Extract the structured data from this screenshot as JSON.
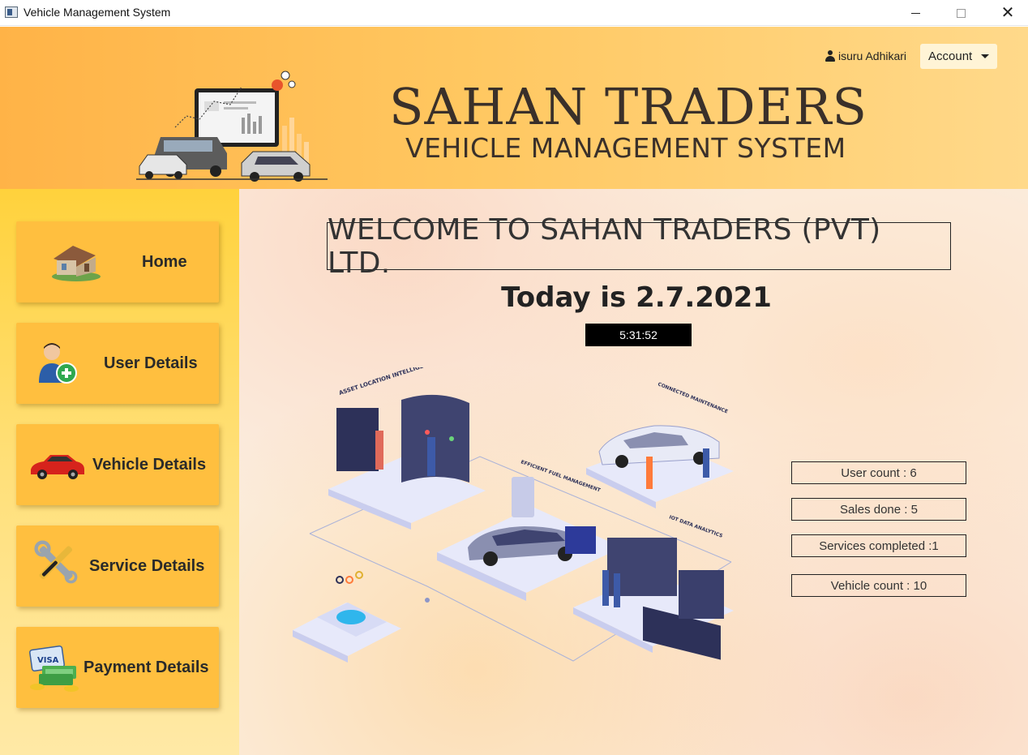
{
  "window": {
    "title": "Vehicle Management System"
  },
  "header": {
    "brand_title": "SAHAN TRADERS",
    "brand_subtitle": "VEHICLE MANAGEMENT SYSTEM",
    "user_name": "isuru Adhikari",
    "account_label": "Account",
    "icons": [
      "user-icon",
      "chevron-down-icon",
      "fleet-logo-illustration"
    ]
  },
  "sidebar": {
    "items": [
      {
        "label": "Home",
        "icon": "house-icon"
      },
      {
        "label": "User Details",
        "icon": "add-user-icon"
      },
      {
        "label": "Vehicle Details",
        "icon": "car-icon"
      },
      {
        "label": "Service Details",
        "icon": "tools-icon"
      },
      {
        "label": "Payment Details",
        "icon": "payment-icon"
      }
    ]
  },
  "main": {
    "welcome": "WELCOME TO SAHAN TRADERS (PVT) LTD.",
    "today": "Today is 2.7.2021",
    "clock": "5:31:52",
    "illustration_labels": {
      "asset": "ASSET LOCATION INTELLIGENCE",
      "fuel": "EFFICIENT FUEL MANAGEMENT",
      "maintenance": "CONNECTED MAINTENANCE",
      "iot": "IOT DATA ANALYTICS"
    },
    "stats": [
      "User count : 6",
      "Sales done : 5",
      "Services completed :1",
      "Vehicle count : 10"
    ]
  },
  "colors": {
    "header_start": "#ffb347",
    "header_end": "#ffd98a",
    "sidebar_button": "#ffbf3f",
    "sidebar_bg": "#ffd23c",
    "text_dark": "#3a302a"
  }
}
